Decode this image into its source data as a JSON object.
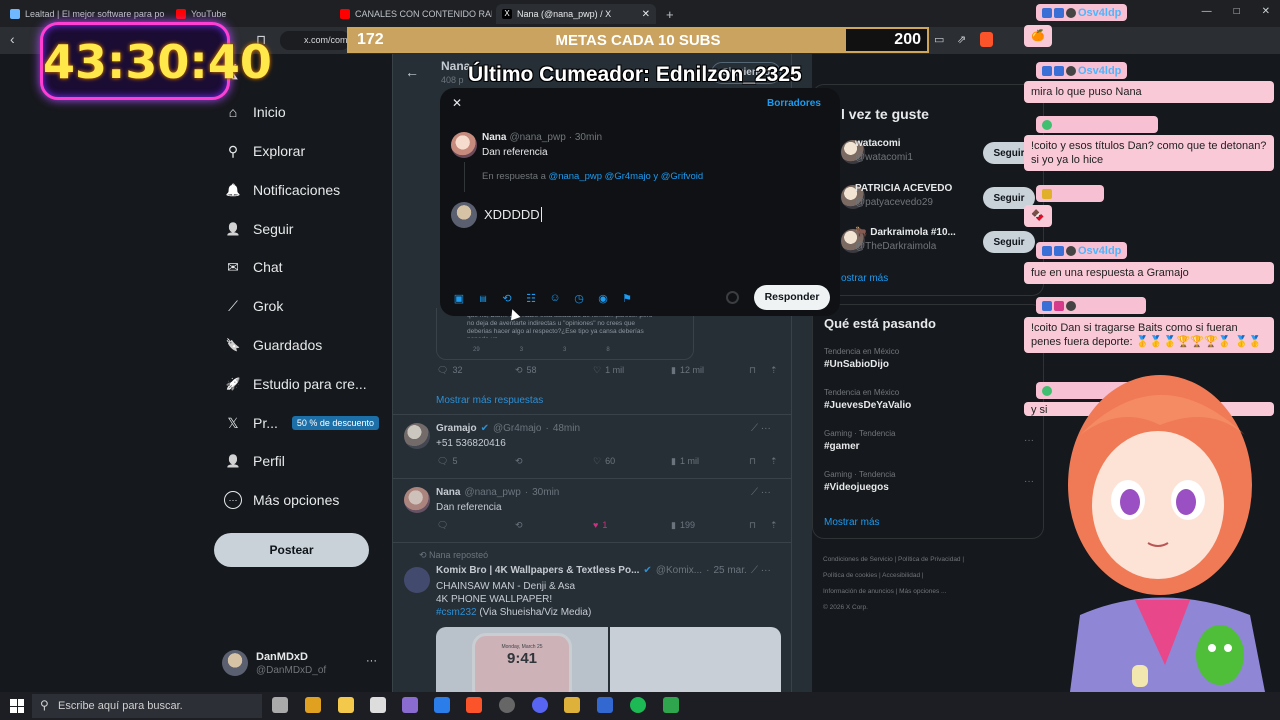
{
  "browser": {
    "tabs": [
      {
        "label": "Lealtad | El mejor software para pote",
        "active": false
      },
      {
        "label": "YouTube",
        "active": false
      },
      {
        "label": "CANALES CON CONTENIDO RARO E",
        "active": false
      },
      {
        "label": "Nana (@nana_pwp) / X",
        "active": true
      }
    ],
    "new_tab": "+",
    "url": "x.com/com",
    "window_controls": [
      "—",
      "□",
      "✕"
    ]
  },
  "sidebar": {
    "items": [
      {
        "label": "Inicio",
        "icon": "home-icon",
        "glyph": "⌂"
      },
      {
        "label": "Explorar",
        "icon": "search-icon",
        "glyph": "⚲"
      },
      {
        "label": "Notificaciones",
        "icon": "bell-icon",
        "glyph": "🔔"
      },
      {
        "label": "Seguir",
        "icon": "person-plus-icon",
        "glyph": "👤"
      },
      {
        "label": "Chat",
        "icon": "mail-icon",
        "glyph": "✉"
      },
      {
        "label": "Grok",
        "icon": "grok-icon",
        "glyph": "⟋"
      },
      {
        "label": "Guardados",
        "icon": "bookmark-icon",
        "glyph": "🔖"
      },
      {
        "label": "Estudio para cre...",
        "icon": "rocket-icon",
        "glyph": "🚀"
      },
      {
        "label": "Pr...",
        "icon": "x-logo-icon",
        "glyph": "𝕏",
        "badge": "50 % de descuento"
      },
      {
        "label": "Perfil",
        "icon": "profile-icon",
        "glyph": "👤"
      },
      {
        "label": "Más opciones",
        "icon": "more-circle-icon",
        "glyph": "⋯"
      }
    ],
    "post_button": "Postear",
    "account": {
      "name": "DanMDxD",
      "handle": "@DanMDxD_of",
      "more": "···"
    }
  },
  "timeline": {
    "header_name": "Nana",
    "header_sub": "408 p",
    "follow_label": "Siguiendo",
    "quoted_text": "que no, Dan... que nadie está actuando de forma... parecer pero no deja de aventarte indirectas u \"opiniones\" no crees que deberias hacer algo al respecto?¿Ese tipo ya cansa deberías ponerle un...",
    "quoted_stats": {
      "replies": "29",
      "reposts": "3",
      "likes": "3",
      "views": "8"
    },
    "main_stats": {
      "replies": "32",
      "reposts": "58",
      "likes": "1 mil",
      "views": "12 mil"
    },
    "show_more": "Mostrar más respuestas",
    "replies": [
      {
        "name": "Gramajo",
        "handle": "@Gr4majo",
        "time": "48min",
        "text": "+51 536820416",
        "replies": "5",
        "reposts": "",
        "likes": "60",
        "views": "1 mil"
      },
      {
        "name": "Nana",
        "handle": "@nana_pwp",
        "time": "30min",
        "text": "Dan referencia",
        "replies": "",
        "reposts": "",
        "likes": "1",
        "views": "199"
      }
    ],
    "repost": {
      "reposted_by": "Nana reposteó",
      "name": "Komix Bro | 4K Wallpapers & Textless Po...",
      "handle": "@Komix...",
      "time": "25 mar.",
      "line1": "CHAINSAW MAN - Denji & Asa",
      "line2": "4K PHONE WALLPAPER!",
      "hashtag": "#csm232",
      "via": " (Via Shueisha/Viz Media)",
      "image_date": "Monday, March 25",
      "image_time": "9:41"
    }
  },
  "modal": {
    "close": "✕",
    "drafts": "Borradores",
    "orig_name": "Nana",
    "orig_handle": "@nana_pwp",
    "orig_time": "· 30min",
    "orig_text": "Dan referencia",
    "replying_prefix": "En respuesta a ",
    "replying_to": "@nana_pwp @Gr4majo y @Grifvoid",
    "compose_text": "XDDDDD",
    "reply_button": "Responder",
    "toolbar_icons": [
      "image-icon",
      "gif-icon",
      "grok-icon",
      "poll-icon",
      "emoji-icon",
      "schedule-icon",
      "location-icon",
      "flag-icon"
    ]
  },
  "right": {
    "suggest_title": "l vez te guste",
    "suggestions": [
      {
        "name": "watacomi",
        "handle": "@watacomi1",
        "button": "Seguir"
      },
      {
        "name": "PATRICIA ACEVEDO",
        "handle": "@patyacevedo29",
        "button": "Seguir"
      },
      {
        "name": "🐂 Darkraimola #10...",
        "handle": "@TheDarkraimola",
        "button": "Seguir"
      }
    ],
    "show_more_1": "ostrar más",
    "trends_title": "Qué está pasando",
    "trends": [
      {
        "context": "Tendencia en México",
        "name": "#UnSabioDijo"
      },
      {
        "context": "Tendencia en México",
        "name": "#JuevesDeYaValio"
      },
      {
        "context": "Gaming · Tendencia",
        "name": "#gamer"
      },
      {
        "context": "Gaming · Tendencia",
        "name": "#Videojuegos"
      }
    ],
    "show_more_2": "Mostrar más",
    "footer": [
      "Condiciones de Servicio",
      "Política de Privacidad",
      "Política de cookies",
      "Accesibilidad",
      "Información de anuncios",
      "Más opciones ...",
      "© 2026 X Corp."
    ]
  },
  "stream": {
    "timer": "43:30:40",
    "goal_current": "172",
    "goal_label": "METAS CADA 10 SUBS",
    "goal_target": "200",
    "goal_progress": 0.86,
    "cumeador": "Último Cumeador: Ednilzon_2325"
  },
  "chat": [
    {
      "user": "Osv4ldp",
      "message": "🍊"
    },
    {
      "user": "Osv4ldp",
      "message": "mira lo que puso Nana"
    },
    {
      "user": "",
      "message": "!coito y esos títulos Dan? como que te detonan? si yo ya lo hice"
    },
    {
      "user": "",
      "message": "🍫"
    },
    {
      "user": "Osv4ldp",
      "message": "fue en una respuesta a Gramajo"
    },
    {
      "user": "",
      "message": "!coito Dan si tragarse Baits como si fueran penes fuera deporte: 🥇🥇🥇🏆🏆🏆🥇 🥇🥇"
    },
    {
      "user": "",
      "message": "y si"
    }
  ],
  "taskbar": {
    "search_placeholder": "Escribe aquí para buscar."
  },
  "colors": {
    "accent": "#1d9bf0",
    "background": "#15181c",
    "chat_pink": "#f9c9d8",
    "timer_gold": "#ffe94a"
  }
}
